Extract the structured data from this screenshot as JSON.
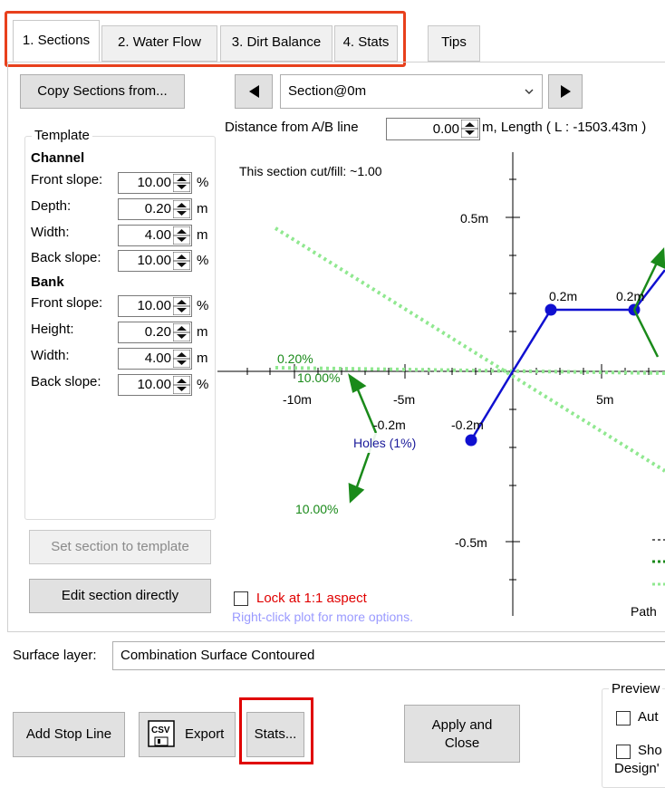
{
  "tabs": [
    {
      "label": "1. Sections"
    },
    {
      "label": "2. Water Flow"
    },
    {
      "label": "3. Dirt Balance"
    },
    {
      "label": "4. Stats"
    },
    {
      "label": "Tips"
    }
  ],
  "toolbar": {
    "copy_sections": "Copy Sections from...",
    "section_selected": "Section@0m",
    "distance_label": "Distance from A/B line",
    "distance_value": "0.00",
    "length_label": "m, Length ( L : -1503.43m )"
  },
  "template": {
    "title": "Template",
    "channel_heading": "Channel",
    "bank_heading": "Bank",
    "channel": [
      {
        "label": "Front slope:",
        "value": "10.00",
        "unit": "%"
      },
      {
        "label": "Depth:",
        "value": "0.20",
        "unit": "m"
      },
      {
        "label": "Width:",
        "value": "4.00",
        "unit": "m"
      },
      {
        "label": "Back slope:",
        "value": "10.00",
        "unit": "%"
      }
    ],
    "bank": [
      {
        "label": "Front slope:",
        "value": "10.00",
        "unit": "%"
      },
      {
        "label": "Height:",
        "value": "0.20",
        "unit": "m"
      },
      {
        "label": "Width:",
        "value": "4.00",
        "unit": "m"
      },
      {
        "label": "Back slope:",
        "value": "10.00",
        "unit": "%"
      }
    ]
  },
  "buttons": {
    "set_section": "Set section to template",
    "edit_section": "Edit section directly",
    "add_stop_line": "Add Stop Line",
    "export": "Export",
    "stats": "Stats...",
    "apply_close_1": "Apply and",
    "apply_close_2": "Close"
  },
  "plot": {
    "cutfill": "This section cut/fill: ~1.00",
    "lock_label": "Lock at 1:1 aspect",
    "hint": "Right-click plot for more options.",
    "y_top": "0.5m",
    "y_bottom": "-0.5m",
    "x_ticks": [
      "-10m",
      "-5m",
      "5m"
    ],
    "pt_labels": [
      "0.2m",
      "0.2m",
      "-0.2m",
      "-0.2m"
    ],
    "slope_labels": [
      "0.20%",
      "10.00%",
      "10.00%"
    ],
    "holes_label": "Holes (1%)",
    "path_label": "Path"
  },
  "surface": {
    "label": "Surface layer:",
    "value": "Combination Surface Contoured"
  },
  "preview": {
    "title": "Preview",
    "opt1": "Aut",
    "opt2": "Sho",
    "opt2b": "Design'"
  },
  "colors": {
    "tab_highlight": "#e8401c",
    "stats_highlight": "#e00000",
    "section_line": "#1010d0",
    "slope_arrow": "#1a8a1a",
    "dotted_ground": "#90e890",
    "lock_text": "#e00000",
    "hint_text": "#9a9aff"
  }
}
